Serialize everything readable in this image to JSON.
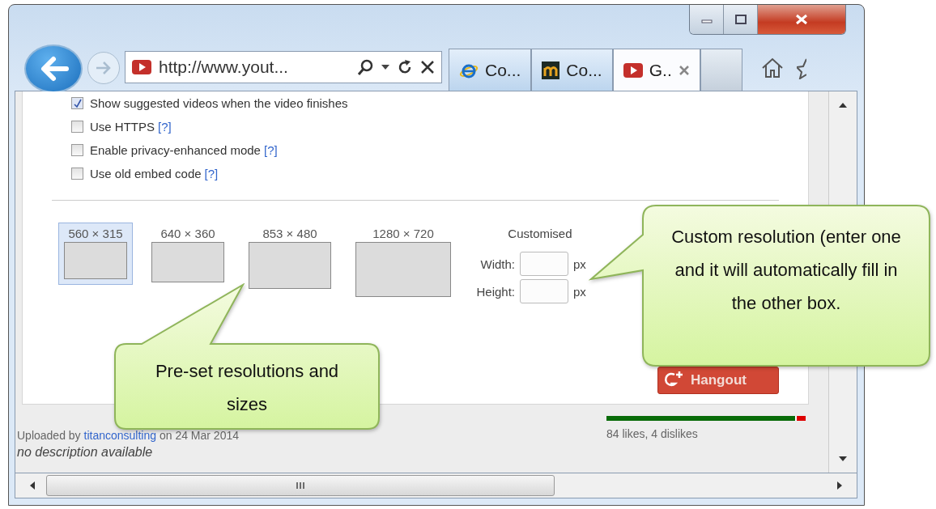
{
  "address_bar": {
    "url": "http://www.yout..."
  },
  "tabs": [
    {
      "label": "Co...",
      "selected": false
    },
    {
      "label": "Co...",
      "selected": false
    },
    {
      "label": "G..",
      "selected": true
    }
  ],
  "options": [
    {
      "label": "Show suggested videos when the video finishes",
      "checked": true
    },
    {
      "label": "Use HTTPS",
      "help": "[?]",
      "checked": false
    },
    {
      "label": "Enable privacy-enhanced mode",
      "help": "[?]",
      "checked": false
    },
    {
      "label": "Use old embed code",
      "help": "[?]",
      "checked": false
    }
  ],
  "sizes": [
    {
      "label": "560 × 315",
      "selected": true
    },
    {
      "label": "640 × 360",
      "selected": false
    },
    {
      "label": "853 × 480",
      "selected": false
    },
    {
      "label": "1280 × 720",
      "selected": false
    }
  ],
  "custom": {
    "title": "Customised",
    "width_label": "Width:",
    "width_unit": "px",
    "height_label": "Height:",
    "height_unit": "px"
  },
  "hangout_button": "Hangout",
  "uploaded": {
    "prefix": "Uploaded by",
    "user": "titanconsulting",
    "suffix": "on 24 Mar 2014"
  },
  "description": "no description available",
  "likes": {
    "level": 0.955,
    "text": "84 likes, 4 dislikes"
  },
  "callouts": [
    {
      "text": "Pre-set resolutions and sizes"
    },
    {
      "text": "Custom resolution (enter one and it will automatically fill in the other box."
    }
  ]
}
